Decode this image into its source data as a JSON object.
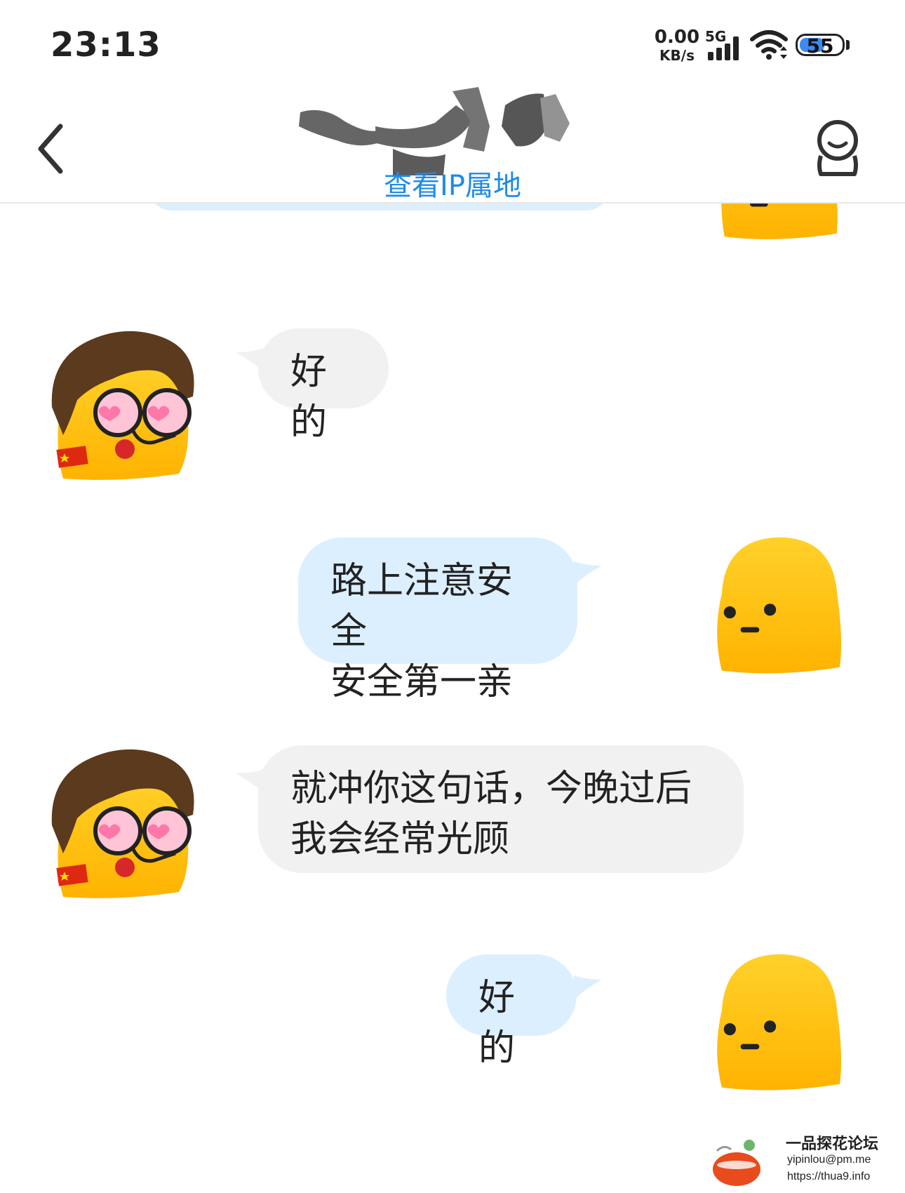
{
  "status_bar": {
    "time": "23:13",
    "network_speed_value": "0.00",
    "network_speed_unit": "KB/s",
    "network_type": "5G",
    "battery_level": "55"
  },
  "header": {
    "ip_link_label": "查看IP属地"
  },
  "messages": [
    {
      "sender": "contact",
      "text": "好的"
    },
    {
      "sender": "me",
      "lines": [
        "路上注意安全",
        "安全第一亲"
      ]
    },
    {
      "sender": "contact",
      "lines": [
        "就冲你这句话，今晚过后",
        "我会经常光顾"
      ]
    },
    {
      "sender": "me",
      "text": "好的"
    }
  ],
  "watermark": {
    "title": "一品探花论坛",
    "email": "yipinlou@pm.me",
    "url": "https://thua9.info"
  },
  "colors": {
    "link_blue": "#1e8be8",
    "incoming_bubble": "#f1f1f1",
    "outgoing_bubble": "#dcefff",
    "avatar_yellow": "#ffc20e"
  }
}
